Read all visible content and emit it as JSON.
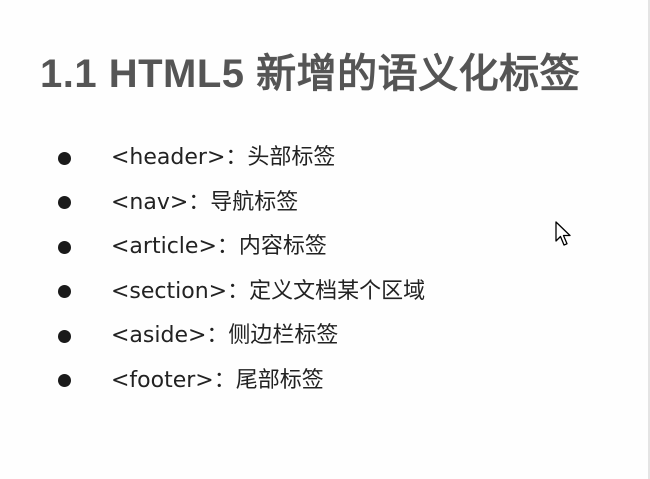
{
  "slide": {
    "title": "1.1 HTML5 新增的语义化标签",
    "bullets": [
      {
        "text": "<header>：头部标签"
      },
      {
        "text": "<nav>：导航标签"
      },
      {
        "text": "<article>：内容标签"
      },
      {
        "text": "<section>：定义文档某个区域"
      },
      {
        "text": "<aside>：侧边栏标签"
      },
      {
        "text": "<footer>：尾部标签"
      }
    ]
  },
  "icons": {
    "bullet": "bullet-dot-icon",
    "cursor": "mouse-pointer-icon"
  },
  "colors": {
    "title": "#555555",
    "text": "#222222",
    "bullet": "#1a1a1a",
    "background": "#fefefe"
  }
}
